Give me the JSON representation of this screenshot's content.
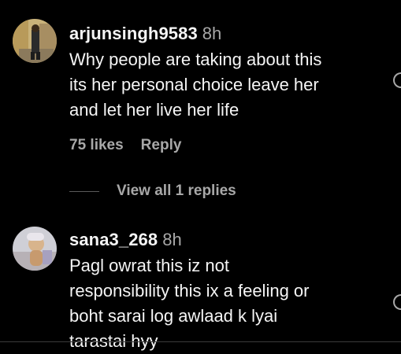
{
  "comments": [
    {
      "username": "arjunsingh9583",
      "time": "8h",
      "lines": [
        "Why people are taking about this",
        "its her personal choice leave her",
        "and let her live her life"
      ],
      "likes": "75 likes",
      "reply": "Reply",
      "view_replies": "View all 1 replies"
    },
    {
      "username": "sana3_268",
      "time": "8h",
      "lines": [
        "Pagl owrat this iz not",
        "responsibility this ix a feeling or",
        "boht sarai log awlaad k lyai",
        "tarastai hyy"
      ]
    }
  ],
  "colors": {
    "background": "#000000",
    "primary_text": "#f5f5f5",
    "secondary_text": "#a8a8a8"
  },
  "icons": {
    "like": "heart-icon"
  }
}
